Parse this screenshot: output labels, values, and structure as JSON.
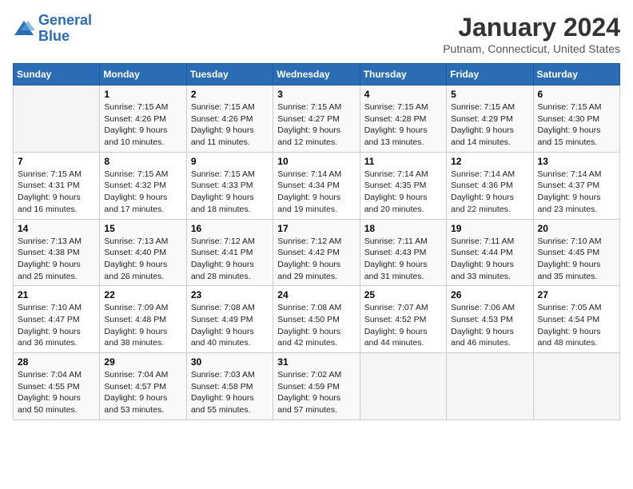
{
  "logo": {
    "line1": "General",
    "line2": "Blue"
  },
  "title": "January 2024",
  "location": "Putnam, Connecticut, United States",
  "days_of_week": [
    "Sunday",
    "Monday",
    "Tuesday",
    "Wednesday",
    "Thursday",
    "Friday",
    "Saturday"
  ],
  "weeks": [
    [
      {
        "day": "",
        "content": ""
      },
      {
        "day": "1",
        "content": "Sunrise: 7:15 AM\nSunset: 4:26 PM\nDaylight: 9 hours\nand 10 minutes."
      },
      {
        "day": "2",
        "content": "Sunrise: 7:15 AM\nSunset: 4:26 PM\nDaylight: 9 hours\nand 11 minutes."
      },
      {
        "day": "3",
        "content": "Sunrise: 7:15 AM\nSunset: 4:27 PM\nDaylight: 9 hours\nand 12 minutes."
      },
      {
        "day": "4",
        "content": "Sunrise: 7:15 AM\nSunset: 4:28 PM\nDaylight: 9 hours\nand 13 minutes."
      },
      {
        "day": "5",
        "content": "Sunrise: 7:15 AM\nSunset: 4:29 PM\nDaylight: 9 hours\nand 14 minutes."
      },
      {
        "day": "6",
        "content": "Sunrise: 7:15 AM\nSunset: 4:30 PM\nDaylight: 9 hours\nand 15 minutes."
      }
    ],
    [
      {
        "day": "7",
        "content": "Sunrise: 7:15 AM\nSunset: 4:31 PM\nDaylight: 9 hours\nand 16 minutes."
      },
      {
        "day": "8",
        "content": "Sunrise: 7:15 AM\nSunset: 4:32 PM\nDaylight: 9 hours\nand 17 minutes."
      },
      {
        "day": "9",
        "content": "Sunrise: 7:15 AM\nSunset: 4:33 PM\nDaylight: 9 hours\nand 18 minutes."
      },
      {
        "day": "10",
        "content": "Sunrise: 7:14 AM\nSunset: 4:34 PM\nDaylight: 9 hours\nand 19 minutes."
      },
      {
        "day": "11",
        "content": "Sunrise: 7:14 AM\nSunset: 4:35 PM\nDaylight: 9 hours\nand 20 minutes."
      },
      {
        "day": "12",
        "content": "Sunrise: 7:14 AM\nSunset: 4:36 PM\nDaylight: 9 hours\nand 22 minutes."
      },
      {
        "day": "13",
        "content": "Sunrise: 7:14 AM\nSunset: 4:37 PM\nDaylight: 9 hours\nand 23 minutes."
      }
    ],
    [
      {
        "day": "14",
        "content": "Sunrise: 7:13 AM\nSunset: 4:38 PM\nDaylight: 9 hours\nand 25 minutes."
      },
      {
        "day": "15",
        "content": "Sunrise: 7:13 AM\nSunset: 4:40 PM\nDaylight: 9 hours\nand 26 minutes."
      },
      {
        "day": "16",
        "content": "Sunrise: 7:12 AM\nSunset: 4:41 PM\nDaylight: 9 hours\nand 28 minutes."
      },
      {
        "day": "17",
        "content": "Sunrise: 7:12 AM\nSunset: 4:42 PM\nDaylight: 9 hours\nand 29 minutes."
      },
      {
        "day": "18",
        "content": "Sunrise: 7:11 AM\nSunset: 4:43 PM\nDaylight: 9 hours\nand 31 minutes."
      },
      {
        "day": "19",
        "content": "Sunrise: 7:11 AM\nSunset: 4:44 PM\nDaylight: 9 hours\nand 33 minutes."
      },
      {
        "day": "20",
        "content": "Sunrise: 7:10 AM\nSunset: 4:45 PM\nDaylight: 9 hours\nand 35 minutes."
      }
    ],
    [
      {
        "day": "21",
        "content": "Sunrise: 7:10 AM\nSunset: 4:47 PM\nDaylight: 9 hours\nand 36 minutes."
      },
      {
        "day": "22",
        "content": "Sunrise: 7:09 AM\nSunset: 4:48 PM\nDaylight: 9 hours\nand 38 minutes."
      },
      {
        "day": "23",
        "content": "Sunrise: 7:08 AM\nSunset: 4:49 PM\nDaylight: 9 hours\nand 40 minutes."
      },
      {
        "day": "24",
        "content": "Sunrise: 7:08 AM\nSunset: 4:50 PM\nDaylight: 9 hours\nand 42 minutes."
      },
      {
        "day": "25",
        "content": "Sunrise: 7:07 AM\nSunset: 4:52 PM\nDaylight: 9 hours\nand 44 minutes."
      },
      {
        "day": "26",
        "content": "Sunrise: 7:06 AM\nSunset: 4:53 PM\nDaylight: 9 hours\nand 46 minutes."
      },
      {
        "day": "27",
        "content": "Sunrise: 7:05 AM\nSunset: 4:54 PM\nDaylight: 9 hours\nand 48 minutes."
      }
    ],
    [
      {
        "day": "28",
        "content": "Sunrise: 7:04 AM\nSunset: 4:55 PM\nDaylight: 9 hours\nand 50 minutes."
      },
      {
        "day": "29",
        "content": "Sunrise: 7:04 AM\nSunset: 4:57 PM\nDaylight: 9 hours\nand 53 minutes."
      },
      {
        "day": "30",
        "content": "Sunrise: 7:03 AM\nSunset: 4:58 PM\nDaylight: 9 hours\nand 55 minutes."
      },
      {
        "day": "31",
        "content": "Sunrise: 7:02 AM\nSunset: 4:59 PM\nDaylight: 9 hours\nand 57 minutes."
      },
      {
        "day": "",
        "content": ""
      },
      {
        "day": "",
        "content": ""
      },
      {
        "day": "",
        "content": ""
      }
    ]
  ]
}
